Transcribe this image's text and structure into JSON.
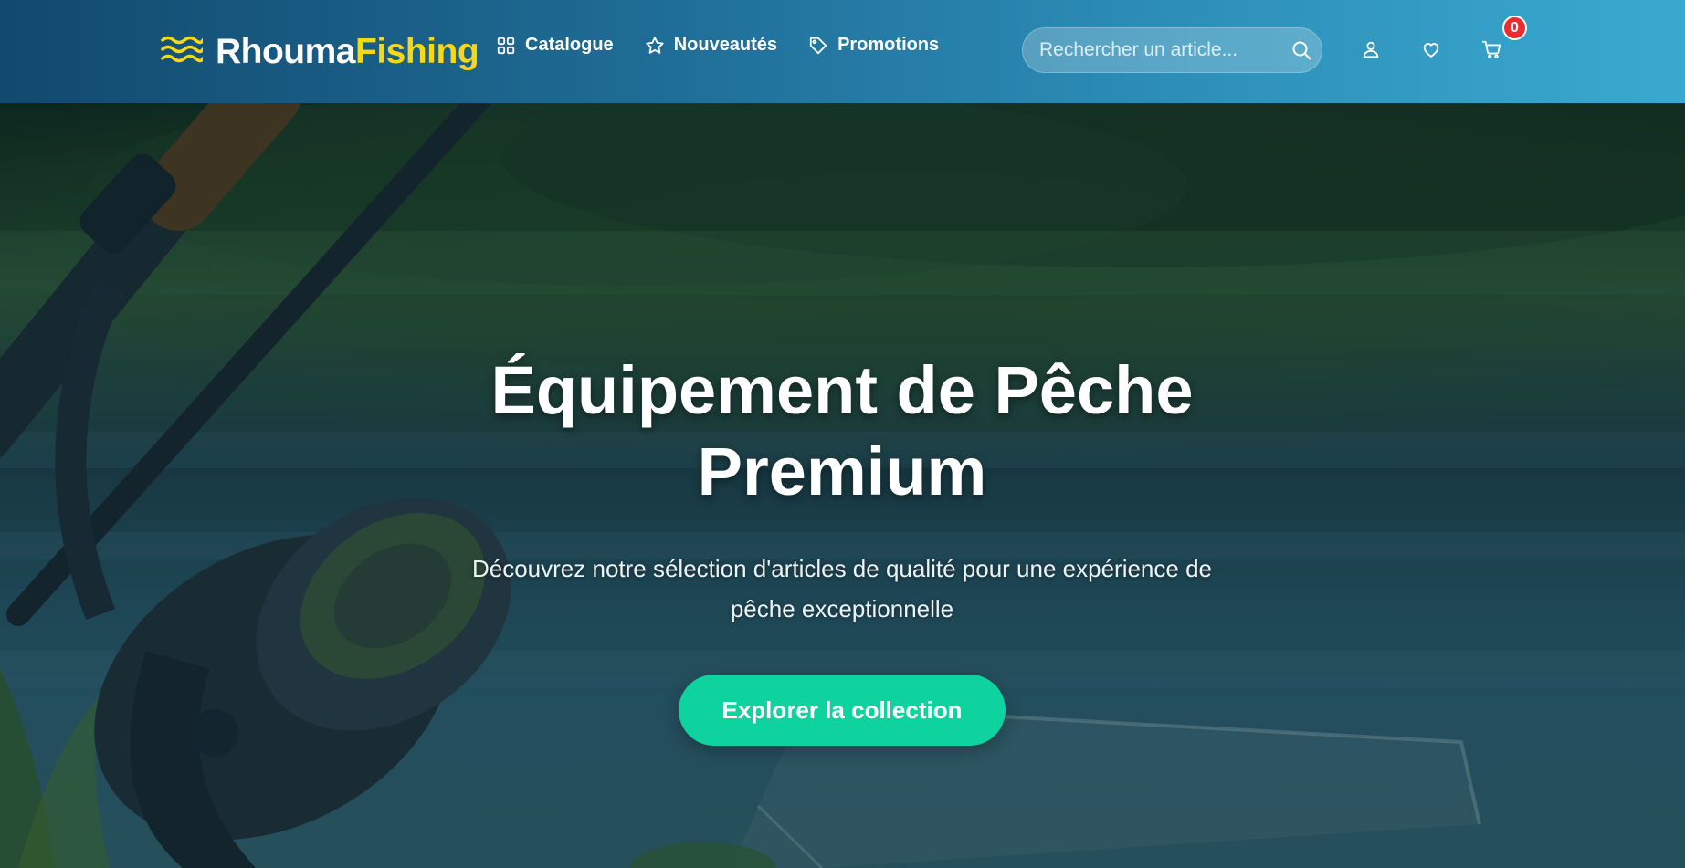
{
  "brand": {
    "name_part1": "Rhouma",
    "name_part2": "Fishing",
    "icon": "waves-icon"
  },
  "nav": [
    {
      "label": "Catalogue",
      "icon": "grid-icon"
    },
    {
      "label": "Nouveautés",
      "icon": "star-icon"
    },
    {
      "label": "Promotions",
      "icon": "tag-icon"
    }
  ],
  "search": {
    "placeholder": "Rechercher un article...",
    "value": "",
    "icon": "search-icon"
  },
  "header_icons": {
    "account": "user-icon",
    "wishlist": "heart-icon",
    "cart": "cart-icon"
  },
  "cart": {
    "count": "0"
  },
  "hero": {
    "title_line1": "Équipement de Pêche",
    "title_line2": "Premium",
    "subtitle": "Découvrez notre sélection d'articles de qualité pour une expérience de pêche exceptionnelle",
    "cta_label": "Explorer la collection"
  },
  "colors": {
    "header_gradient_start": "#12496e",
    "header_gradient_end": "#3aa9cf",
    "brand_accent": "#f7d816",
    "cta": "#0fd39f",
    "badge": "#ef2b2b"
  }
}
